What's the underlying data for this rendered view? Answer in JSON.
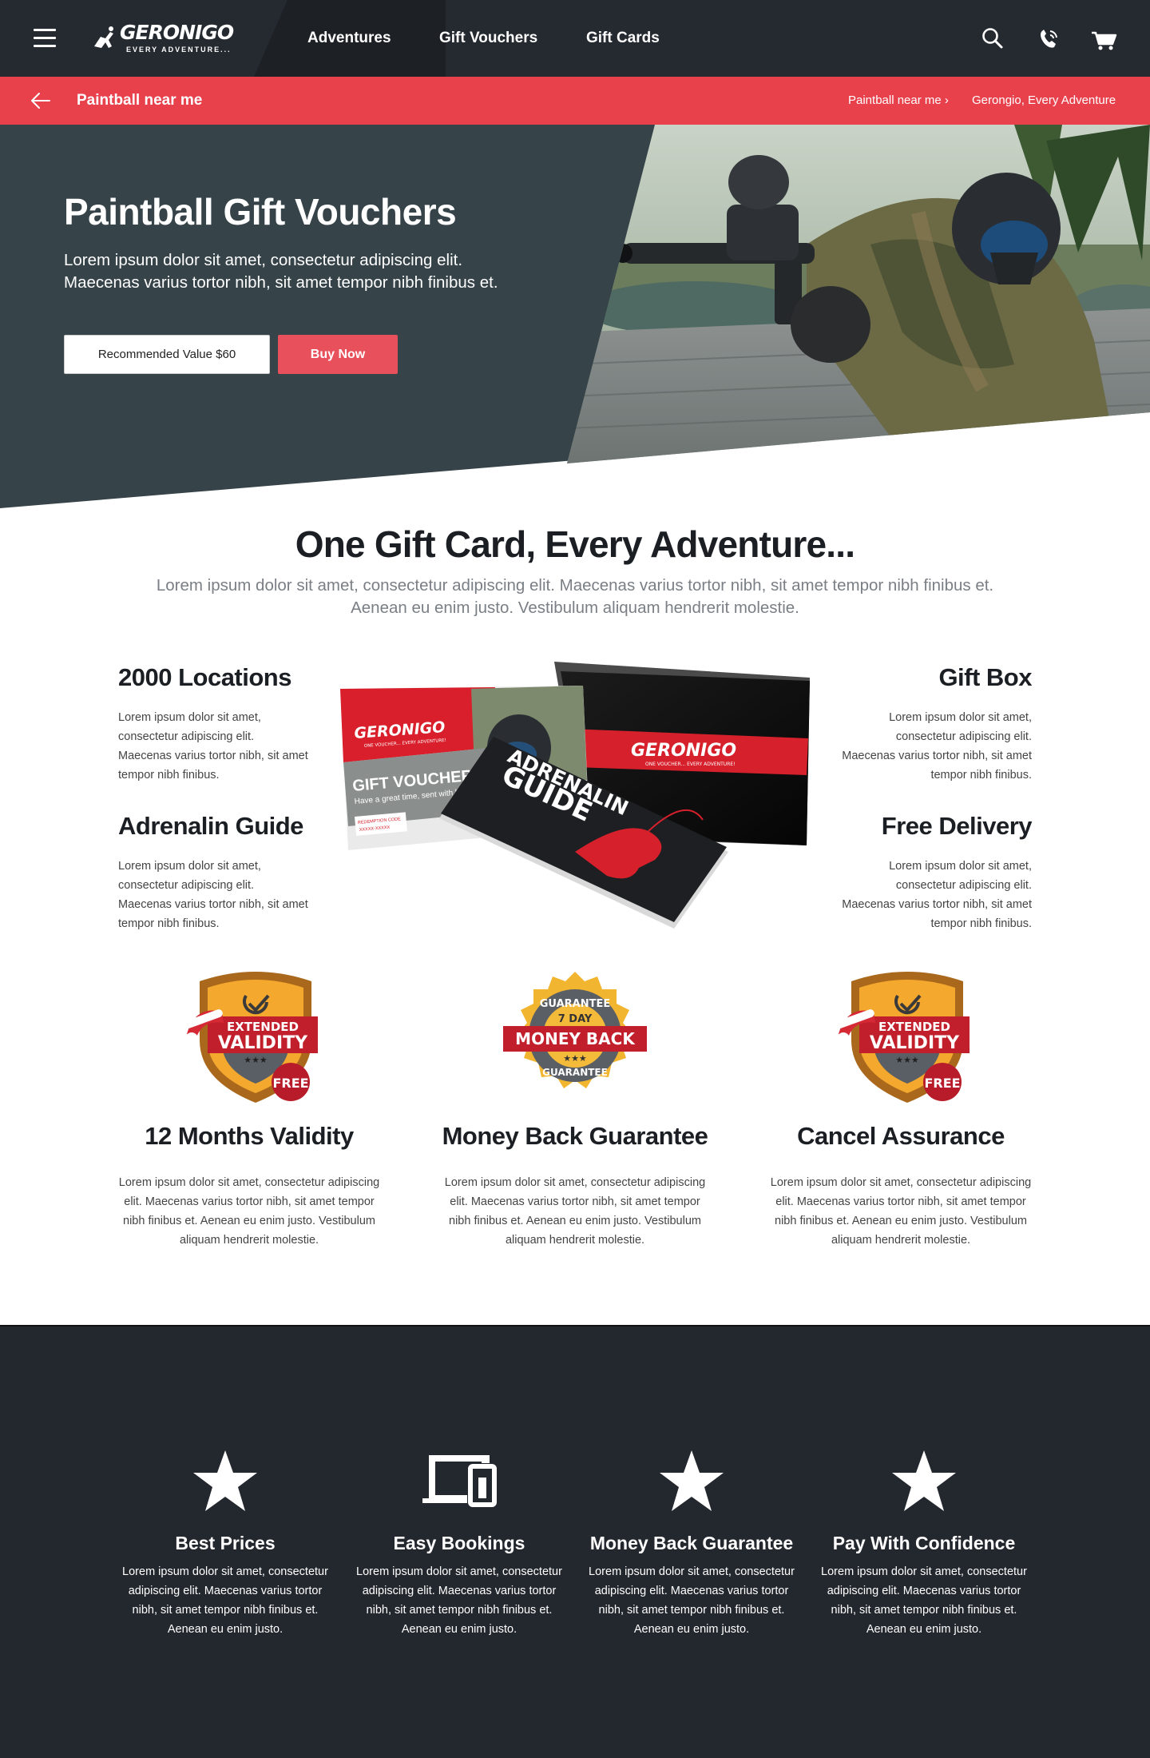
{
  "header": {
    "logo_text": "GERONIGO",
    "logo_tagline": "EVERY ADVENTURE...",
    "nav": [
      "Adventures",
      "Gift Vouchers",
      "Gift Cards"
    ]
  },
  "breadcrumb_bar": {
    "title": "Paintball near me",
    "crumbs": [
      "Paintball near me ›",
      "Gerongio, Every Adventure"
    ]
  },
  "hero": {
    "title": "Paintball Gift Vouchers",
    "text": "Lorem ipsum dolor sit amet, consectetur adipiscing elit. Maecenas varius tortor nibh, sit amet tempor nibh finibus et.",
    "value_button": "Recommended Value $60",
    "buy_button": "Buy Now"
  },
  "gift_section": {
    "title": "One Gift Card, Every Adventure...",
    "subtitle": "Lorem ipsum dolor sit amet, consectetur adipiscing elit. Maecenas varius tortor nibh, sit amet tempor nibh finibus et. Aenean eu enim justo. Vestibulum aliquam hendrerit molestie.",
    "features": [
      {
        "title": "2000 Locations",
        "text": "Lorem ipsum dolor sit amet, consectetur adipiscing elit. Maecenas varius tortor nibh, sit amet tempor nibh finibus."
      },
      {
        "title": "Adrenalin Guide",
        "text": "Lorem ipsum dolor sit amet, consectetur adipiscing elit. Maecenas varius tortor nibh, sit amet tempor nibh finibus."
      },
      {
        "title": "Gift Box",
        "text": "Lorem ipsum dolor sit amet, consectetur adipiscing elit. Maecenas varius tortor nibh, sit amet tempor nibh finibus."
      },
      {
        "title": "Free Delivery",
        "text": "Lorem ipsum dolor sit amet, consectetur adipiscing elit. Maecenas varius tortor nibh, sit amet tempor nibh finibus."
      }
    ],
    "product": {
      "voucher_brand": "GERONIGO",
      "voucher_tagline": "ONE VOUCHER... EVERY ADVENTURE!",
      "voucher_title": "GIFT VOUCHER",
      "voucher_message": "Have a great time, sent with love xxx",
      "redemption_label": "REDEMPTION CODE",
      "redemption_code": "XXXXX-XXXXX",
      "box_brand": "GERONIGO",
      "box_tagline": "ONE VOUCHER... EVERY ADVENTURE!",
      "guide_title_1": "ADRENALIN",
      "guide_title_2": "GUIDE"
    }
  },
  "guarantees": [
    {
      "badge_line1": "EXTENDED",
      "badge_line2": "VALIDITY",
      "badge_extra": "FREE",
      "title": "12 Months Validity",
      "text": "Lorem ipsum dolor sit amet, consectetur adipiscing elit. Maecenas varius tortor nibh, sit amet tempor nibh finibus et. Aenean eu enim justo. Vestibulum aliquam hendrerit molestie."
    },
    {
      "badge_top": "GUARANTEE",
      "badge_days": "7 DAY",
      "badge_main": "MONEY BACK",
      "badge_bottom": "GUARANTEE",
      "title": "Money Back Guarantee",
      "text": "Lorem ipsum dolor sit amet, consectetur adipiscing elit. Maecenas varius tortor nibh, sit amet tempor nibh finibus et. Aenean eu enim justo. Vestibulum aliquam hendrerit molestie."
    },
    {
      "badge_line1": "EXTENDED",
      "badge_line2": "VALIDITY",
      "badge_extra": "FREE",
      "title": "Cancel Assurance",
      "text": "Lorem ipsum dolor sit amet, consectetur adipiscing elit. Maecenas varius tortor nibh, sit amet tempor nibh finibus et. Aenean eu enim justo. Vestibulum aliquam hendrerit molestie."
    }
  ],
  "footer_features": [
    {
      "icon": "star-icon",
      "title": "Best Prices",
      "text": "Lorem ipsum dolor sit amet, consectetur adipiscing elit. Maecenas varius tortor nibh, sit amet tempor nibh finibus et. Aenean eu enim justo."
    },
    {
      "icon": "devices-icon",
      "title": "Easy Bookings",
      "text": "Lorem ipsum dolor sit amet, consectetur adipiscing elit. Maecenas varius tortor nibh, sit amet tempor nibh finibus et. Aenean eu enim justo."
    },
    {
      "icon": "star-icon",
      "title": "Money Back Guarantee",
      "text": "Lorem ipsum dolor sit amet, consectetur adipiscing elit. Maecenas varius tortor nibh, sit amet tempor nibh finibus et. Aenean eu enim justo."
    },
    {
      "icon": "star-icon",
      "title": "Pay With Confidence",
      "text": "Lorem ipsum dolor sit amet, consectetur adipiscing elit. Maecenas varius tortor nibh, sit amet tempor nibh finibus et. Aenean eu enim justo."
    }
  ],
  "colors": {
    "header": "#252a30",
    "accent": "#e8414c",
    "hero": "#364349",
    "dark_section": "#23272e"
  }
}
